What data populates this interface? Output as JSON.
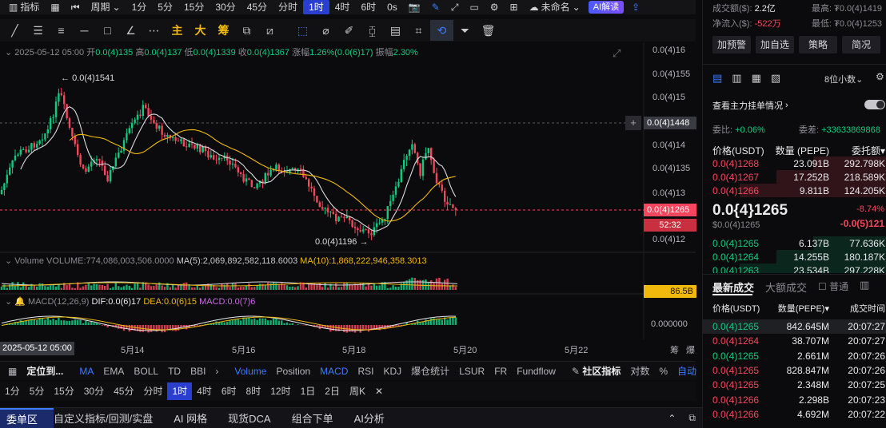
{
  "toolbar": {
    "indicator_label": "指标",
    "period_label": "周期",
    "intervals": [
      "1分",
      "5分",
      "15分",
      "30分",
      "45分",
      "分时",
      "1时",
      "4时",
      "6时"
    ],
    "active_interval": "1时",
    "zero_s": "0s",
    "layout_name": "未命名",
    "ai_label": "AI解读"
  },
  "drawtools": {
    "zhu": "主",
    "da": "大",
    "chou": "筹"
  },
  "chart": {
    "info": {
      "date": "2025-05-12 05:00",
      "open_l": "开",
      "open": "0.0(4)135",
      "high_l": "高",
      "high": "0.0(4)137",
      "low_l": "低",
      "low": "0.0(4)1339",
      "close_l": "收",
      "close": "0.0(4)1367",
      "chg_l": "涨幅",
      "chg": "1.26%(0.0(6)17)",
      "amp_l": "振幅",
      "amp": "2.30%"
    },
    "price_axis": [
      "0.0(4)16",
      "0.0(4)155",
      "0.0(4)15",
      "0.0(4)14",
      "0.0(4)135",
      "0.0(4)13",
      "0.0(4)12"
    ],
    "crosshair_price": "0.0(4)1448",
    "current_price": "0.0(4)1265",
    "countdown": "52:32",
    "high_marker": "0.0(4)1541",
    "low_marker": "0.0(4)1196",
    "volume_line": {
      "label": "Volume",
      "vol": "VOLUME:774,086,003,506.0000",
      "ma5": "MA(5):2,069,892,582,118.6003",
      "ma10": "MA(10):1,868,222,946,358.3013"
    },
    "volume_tag": "86.5B",
    "macd_line": {
      "label": "MACD(12,26,9)",
      "dif": "DIF:0.0(6)17",
      "dea": "DEA:0.0(6)15",
      "macd": "MACD:0.0(7)6"
    },
    "macd_zero": "0.000000",
    "date_cursor": "2025-05-12 05:00",
    "date_axis": [
      "5月14",
      "5月16",
      "5月18",
      "5月20",
      "5月22"
    ],
    "corner_a": "筹",
    "corner_b": "爆"
  },
  "indicators": {
    "locate": "定位到...",
    "main": [
      "MA",
      "EMA",
      "BOLL",
      "TD",
      "BBI"
    ],
    "sub": [
      "Volume",
      "Position",
      "MACD",
      "RSI",
      "KDJ",
      "爆仓统计",
      "LSUR",
      "FR",
      "Fundflow"
    ],
    "community": "社区指标",
    "log": "对数",
    "pct": "%",
    "auto": "自动"
  },
  "periods": {
    "items": [
      "1分",
      "5分",
      "15分",
      "30分",
      "45分",
      "分时",
      "1时",
      "4时",
      "6时",
      "8时",
      "12时",
      "1日",
      "2日",
      "周K"
    ],
    "active": "1时"
  },
  "bottom_tabs": [
    "委单区",
    "自定义指标/回测/实盘",
    "AI 网格",
    "现货DCA",
    "组合下单",
    "AI分析"
  ],
  "stats": {
    "turnover_l": "成交额($):",
    "turnover": "2.2亿",
    "netflow_l": "净流入($):",
    "netflow": "-522万",
    "high_l": "最高:",
    "high": "₮0.0(4)1419",
    "low_l": "最低:",
    "low": "₮0.0(4)1253"
  },
  "actions": [
    "加预警",
    "加自选",
    "策略",
    "简况"
  ],
  "orderbook": {
    "precision": "8位小数",
    "mainforce": "查看主力挂单情况",
    "ratio_l": "委比:",
    "ratio": "+0.06%",
    "diff_l": "委差:",
    "diff": "+33633869868",
    "headers": [
      "价格(USDT)",
      "数量 (PEPE)",
      "委托额"
    ],
    "asks": [
      {
        "price": "0.0(4)1268",
        "qty": "23.091B",
        "amt": "292.798K"
      },
      {
        "price": "0.0(4)1267",
        "qty": "17.252B",
        "amt": "218.589K"
      },
      {
        "price": "0.0(4)1266",
        "qty": "9.811B",
        "amt": "124.205K"
      }
    ],
    "last_price": "0.0{4}1265",
    "last_price_usd": "$0.0(4)1265",
    "last_chg": "-8.74%",
    "last_chg_abs": "-0.0(5)121",
    "bids": [
      {
        "price": "0.0(4)1265",
        "qty": "6.137B",
        "amt": "77.636K"
      },
      {
        "price": "0.0(4)1264",
        "qty": "14.255B",
        "amt": "180.187K"
      },
      {
        "price": "0.0(4)1263",
        "qty": "23.534B",
        "amt": "297.228K"
      }
    ]
  },
  "trades": {
    "tab_latest": "最新成交",
    "tab_big": "大额成交",
    "normal": "普通",
    "headers": [
      "价格(USDT)",
      "数量(PEPE)",
      "成交时间"
    ],
    "rows": [
      {
        "price": "0.0(4)1265",
        "qty": "842.645M",
        "time": "20:07:27",
        "side": "buy"
      },
      {
        "price": "0.0(4)1264",
        "qty": "38.707M",
        "time": "20:07:27",
        "side": "sell"
      },
      {
        "price": "0.0(4)1265",
        "qty": "2.661M",
        "time": "20:07:26",
        "side": "buy"
      },
      {
        "price": "0.0(4)1265",
        "qty": "828.847M",
        "time": "20:07:26",
        "side": "sell"
      },
      {
        "price": "0.0(4)1265",
        "qty": "2.348M",
        "time": "20:07:25",
        "side": "sell"
      },
      {
        "price": "0.0(4)1266",
        "qty": "2.298B",
        "time": "20:07:23",
        "side": "sell"
      },
      {
        "price": "0.0(4)1266",
        "qty": "4.692M",
        "time": "20:07:22",
        "side": "sell"
      }
    ]
  },
  "colors": {
    "up": "#0ecb81",
    "down": "#f6465d",
    "accent": "#2a3ed0",
    "gold": "#f0b90b"
  }
}
